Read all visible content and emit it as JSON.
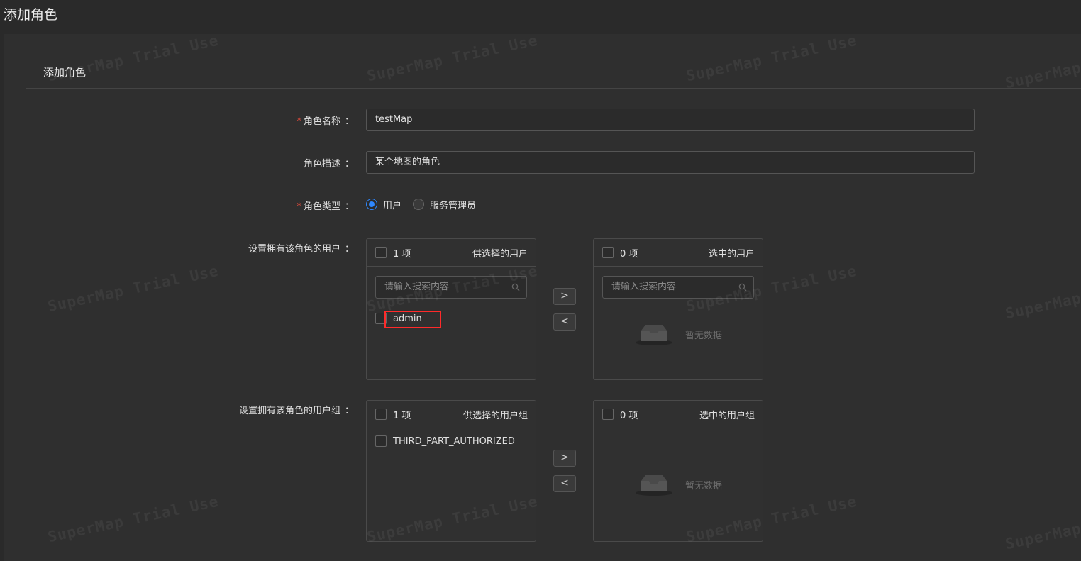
{
  "page": {
    "title": "添加角色"
  },
  "card": {
    "title": "添加角色"
  },
  "form": {
    "name": {
      "label": "角色名称",
      "required": true,
      "value": "testMap"
    },
    "desc": {
      "label": "角色描述",
      "required": false,
      "value": "某个地图的角色"
    },
    "type": {
      "label": "角色类型",
      "required": true,
      "options": [
        {
          "label": "用户",
          "checked": true
        },
        {
          "label": "服务管理员",
          "checked": false
        }
      ]
    },
    "colon": "："
  },
  "users": {
    "label": "设置拥有该角色的用户",
    "source": {
      "count": "1 项",
      "title": "供选择的用户",
      "search_placeholder": "请输入搜索内容",
      "items": [
        "admin"
      ]
    },
    "target": {
      "count": "0 项",
      "title": "选中的用户",
      "search_placeholder": "请输入搜索内容",
      "empty": "暂无数据"
    }
  },
  "groups": {
    "label": "设置拥有该角色的用户组",
    "source": {
      "count": "1 项",
      "title": "供选择的用户组",
      "items": [
        "THIRD_PART_AUTHORIZED"
      ]
    },
    "target": {
      "count": "0 项",
      "title": "选中的用户组",
      "empty": "暂无数据"
    }
  },
  "buttons": {
    "move_right": ">",
    "move_left": "<"
  },
  "watermark": "SuperMap Trial Use",
  "colors": {
    "accent": "#2f88ff",
    "required": "#e74c3c",
    "highlight": "#ff2a2a"
  }
}
